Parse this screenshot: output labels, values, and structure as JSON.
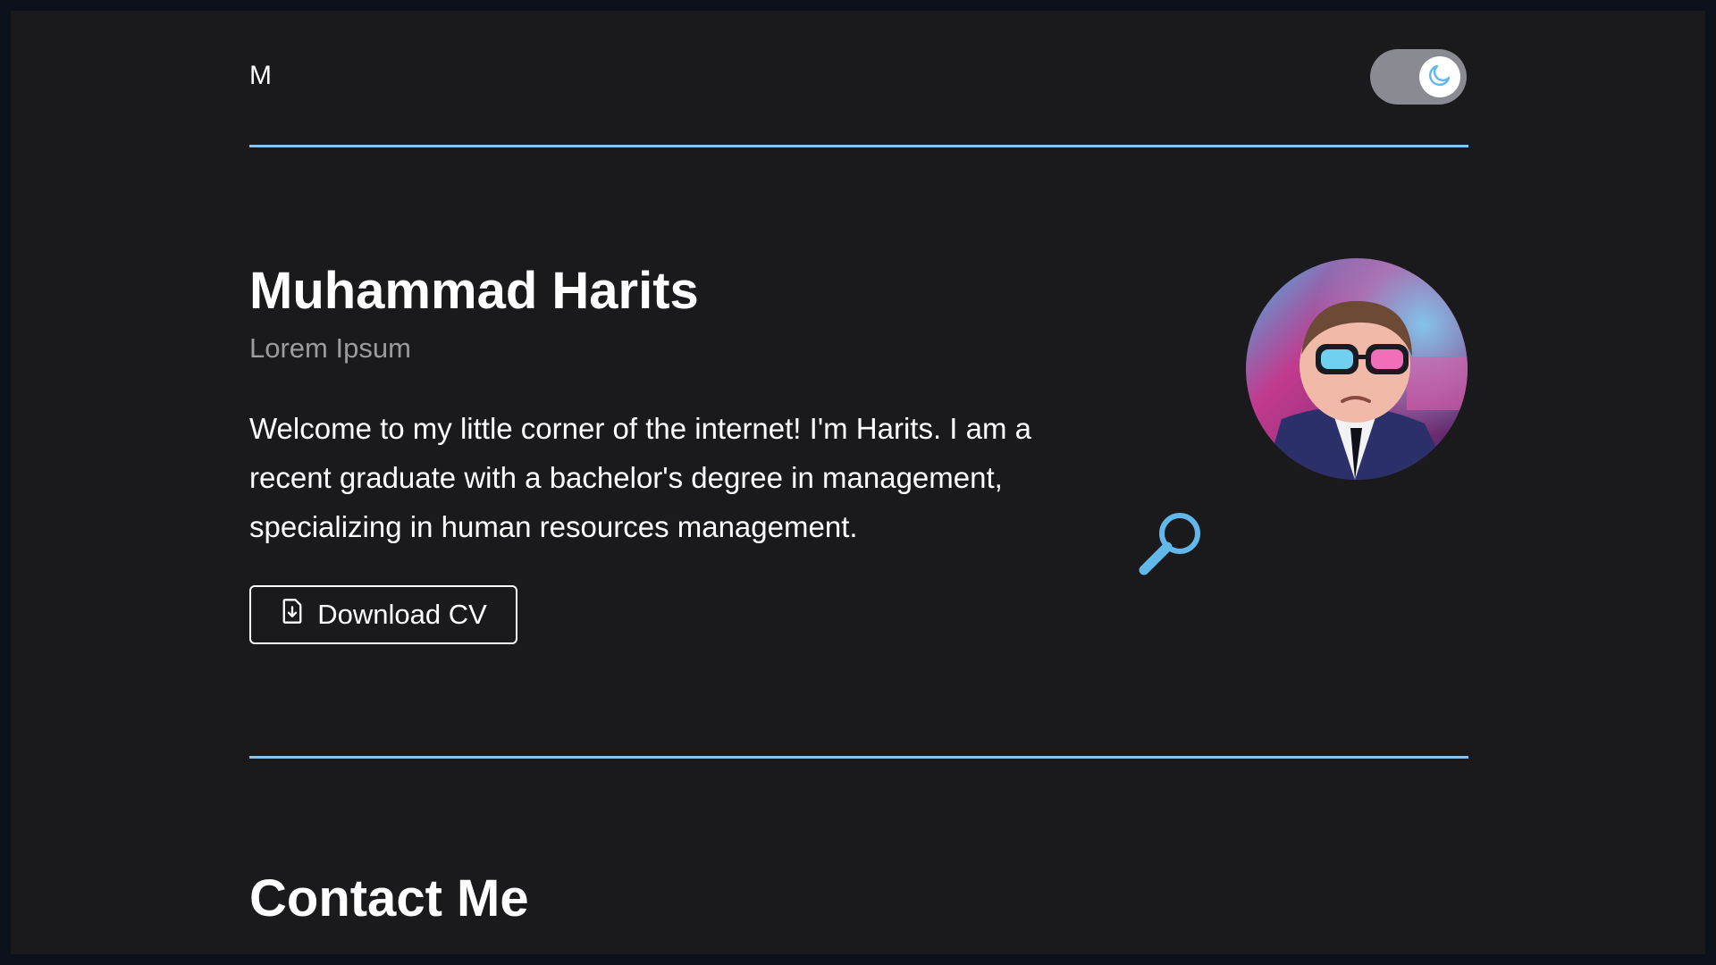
{
  "header": {
    "logo": "M",
    "theme_toggle": {
      "state": "dark",
      "icon": "moon-icon"
    }
  },
  "hero": {
    "name": "Muhammad Harits",
    "subtitle": "Lorem Ipsum",
    "bio": "Welcome to my little corner of the internet! I'm Harits. I am a recent graduate with a bachelor's degree in management, specializing in human resources management.",
    "download_cv_label": "Download CV",
    "download_cv_icon": "file-download-icon",
    "avatar_icon": "avatar-image"
  },
  "contact": {
    "title": "Contact Me"
  },
  "colors": {
    "accent": "#88c3ee",
    "background": "#1a1a1c",
    "outer_background": "#0c111b",
    "text": "#ffffff",
    "muted_text": "#9b9ba0"
  }
}
